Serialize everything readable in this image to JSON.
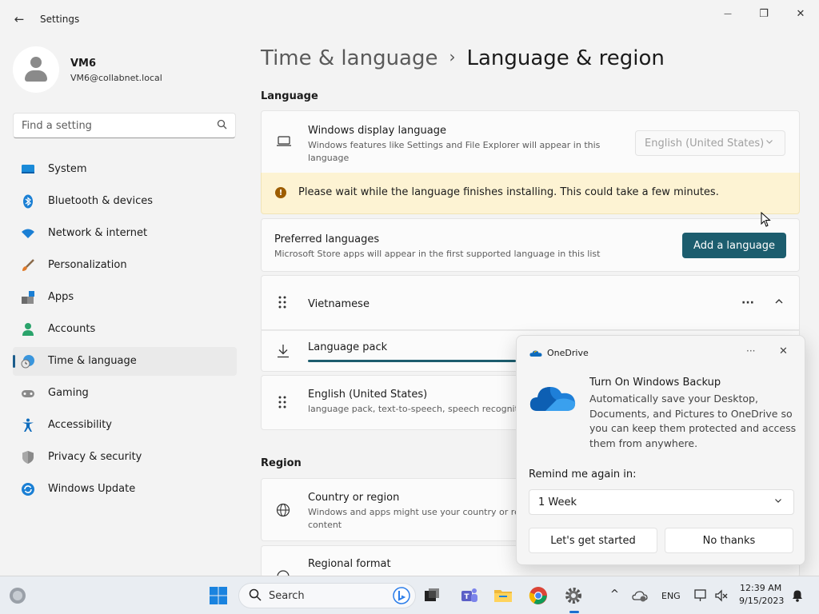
{
  "window": {
    "title": "Settings",
    "back_icon": "←",
    "minimize_icon": "—",
    "maximize_icon": "❐",
    "close_icon": "✕"
  },
  "profile": {
    "name": "VM6",
    "email": "VM6@collabnet.local"
  },
  "search": {
    "placeholder": "Find a setting",
    "icon": "⌕"
  },
  "sidebar": {
    "items": [
      {
        "label": "System",
        "icon": "system-icon",
        "color": "#0078d4"
      },
      {
        "label": "Bluetooth & devices",
        "icon": "bluetooth-icon",
        "color": "#0078d4"
      },
      {
        "label": "Network & internet",
        "icon": "wifi-icon",
        "color": "#0078d4"
      },
      {
        "label": "Personalization",
        "icon": "brush-icon",
        "color": "#e07a2a"
      },
      {
        "label": "Apps",
        "icon": "apps-icon",
        "color": "#555555"
      },
      {
        "label": "Accounts",
        "icon": "accounts-icon",
        "color": "#2aa36b"
      },
      {
        "label": "Time & language",
        "icon": "globe-clock-icon",
        "color": "#0078d4",
        "active": true
      },
      {
        "label": "Gaming",
        "icon": "gamepad-icon",
        "color": "#777777"
      },
      {
        "label": "Accessibility",
        "icon": "accessibility-icon",
        "color": "#0f6cbd"
      },
      {
        "label": "Privacy & security",
        "icon": "shield-icon",
        "color": "#777777"
      },
      {
        "label": "Windows Update",
        "icon": "update-icon",
        "color": "#0078d4"
      }
    ]
  },
  "breadcrumb": {
    "parent": "Time & language",
    "separator": "›",
    "current": "Language & region"
  },
  "language": {
    "section_title": "Language",
    "display": {
      "title": "Windows display language",
      "desc_line1": "Windows features like Settings and File Explorer will appear in this",
      "desc_line2": "language",
      "value": "English (United States)",
      "chevron": "⌄"
    },
    "warning": {
      "icon": "!",
      "text": "Please wait while the language finishes installing. This could take a few minutes."
    },
    "preferred": {
      "title": "Preferred languages",
      "desc": "Microsoft Store apps will appear in the first supported language in this list",
      "button": "Add a language"
    },
    "vietnamese": {
      "name": "Vietnamese",
      "more": "···",
      "collapse": "⌃",
      "pack_label": "Language pack"
    },
    "english": {
      "name": "English (United States)",
      "desc": "language pack, text-to-speech, speech recogniti"
    }
  },
  "region": {
    "section_title": "Region",
    "country": {
      "title": "Country or region",
      "desc_line1": "Windows and apps might use your country or re",
      "desc_line2": "content"
    },
    "format": {
      "title": "Regional format"
    }
  },
  "onedrive": {
    "brand": "OneDrive",
    "more": "···",
    "close": "✕",
    "heading": "Turn On Windows Backup",
    "body": "Automatically save your Desktop, Documents, and Pictures to OneDrive so you can keep them protected and access them from anywhere.",
    "remind_label": "Remind me again in:",
    "remind_value": "1 Week",
    "chevron": "⌄",
    "primary": "Let's get started",
    "secondary": "No thanks"
  },
  "taskbar": {
    "search_label": "Search",
    "language": "ENG",
    "time": "12:39 AM",
    "date": "9/15/2023",
    "tray_chevron": "^"
  }
}
